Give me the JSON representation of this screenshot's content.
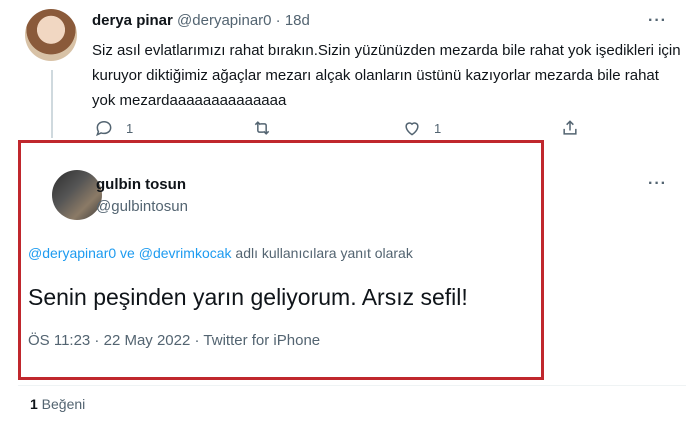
{
  "reply": {
    "display_name": "derya pinar",
    "handle": "@deryapinar0",
    "separator": "·",
    "age": "18d",
    "more_icon": "more-horizontal-icon",
    "text": "Siz asıl evlatlarımızı rahat bırakın.Sizin yüzünüzden mezarda bile rahat yok işedikleri için kuruyor diktiğimiz ağaçlar mezarı alçak olanların üstünü kazıyorlar mezarda bile rahat yok mezardaaaaaaaaaaaaaa",
    "actions": {
      "reply_count": "1",
      "like_count": "1"
    }
  },
  "tweet": {
    "display_name": "gulbin tosun",
    "handle": "@gulbintosun",
    "replying": {
      "mention1": "@deryapinar0",
      "connector": " ve ",
      "mention2": "@devrimkocak",
      "suffix": " adlı kullanıcılara yanıt olarak"
    },
    "text": "Senin peşinden yarın geliyorum. Arsız sefil!",
    "time": "ÖS 11:23",
    "dot": " · ",
    "date": "22 May 2022",
    "source": "Twitter for iPhone"
  },
  "stats": {
    "like_count": "1",
    "like_label": " Beğeni"
  },
  "colors": {
    "highlight_border": "#c0272d",
    "link": "#1d9bf0",
    "muted": "#536471"
  }
}
